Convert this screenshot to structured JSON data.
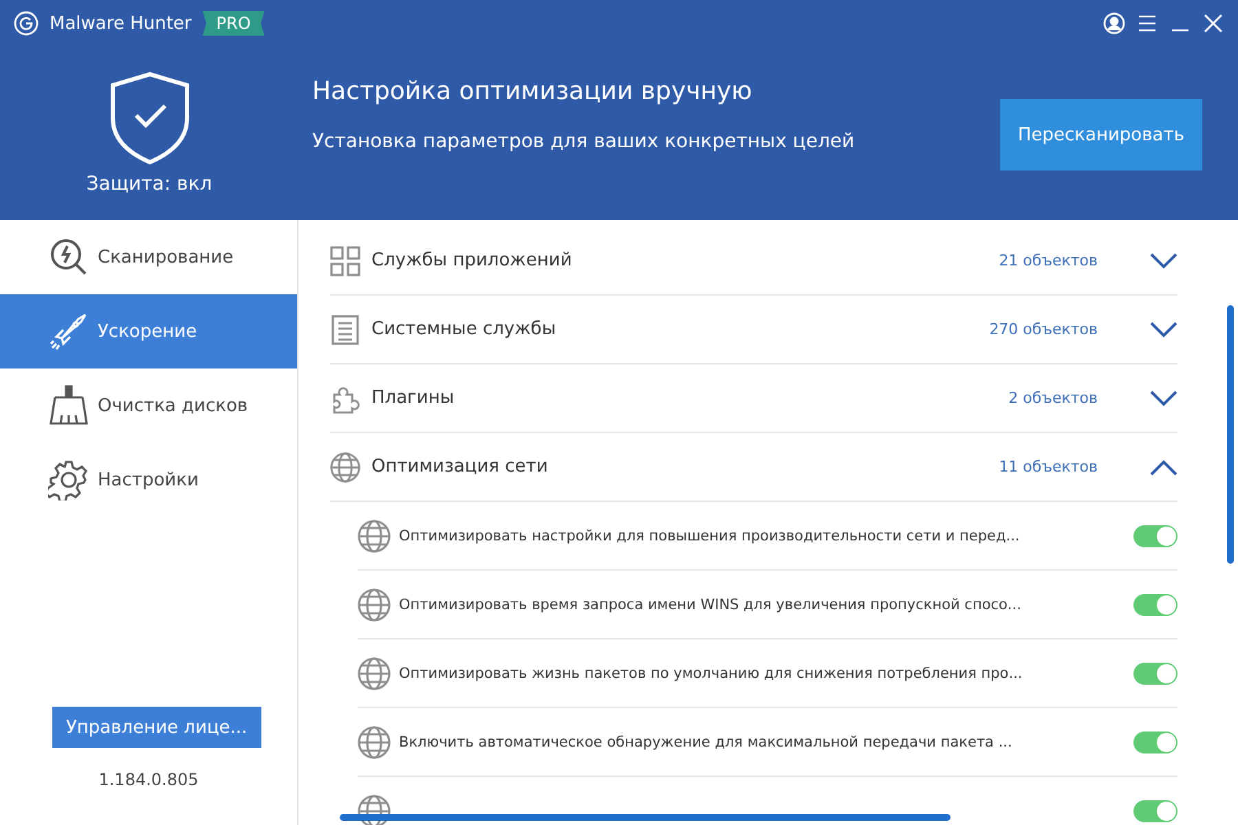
{
  "app": {
    "name": "Malware Hunter",
    "badge": "PRO"
  },
  "header": {
    "status": "Защита: вкл",
    "title": "Настройка оптимизации вручную",
    "subtitle": "Установка параметров для ваших конкретных целей",
    "rescan_button": "Пересканировать"
  },
  "sidebar": {
    "items": [
      {
        "kind": "scan",
        "label": "Сканирование",
        "selected": false
      },
      {
        "kind": "boost",
        "label": "Ускорение",
        "selected": true
      },
      {
        "kind": "clean",
        "label": "Очистка дисков",
        "selected": false
      },
      {
        "kind": "settings",
        "label": "Настройки",
        "selected": false
      }
    ],
    "license_button": "Управление лице...",
    "version": "1.184.0.805"
  },
  "sections": [
    {
      "kind": "apps",
      "title": "Службы приложений",
      "count": "21 объектов",
      "expanded": false
    },
    {
      "kind": "system",
      "title": "Системные службы",
      "count": "270 объектов",
      "expanded": false
    },
    {
      "kind": "plugins",
      "title": "Плагины",
      "count": "2 объектов",
      "expanded": false
    },
    {
      "kind": "network",
      "title": "Оптимизация сети",
      "count": "11 объектов",
      "expanded": true,
      "items": [
        {
          "label": "Оптимизировать настройки для повышения производительности сети и перед...",
          "on": true
        },
        {
          "label": "Оптимизировать время запроса имени WINS для увеличения пропускной спосо...",
          "on": true
        },
        {
          "label": "Оптимизировать жизнь пакетов по умолчанию для снижения потребления про...",
          "on": true
        },
        {
          "label": "Включить автоматическое обнаружение для максимальной передачи пакета ...",
          "on": true
        },
        {
          "on": true
        }
      ]
    }
  ]
}
